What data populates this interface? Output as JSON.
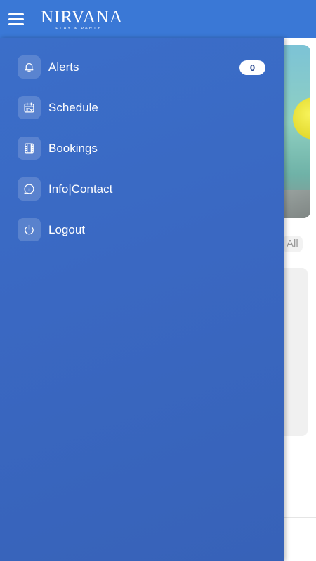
{
  "app": {
    "logo_main": "NIRVANA",
    "logo_sub": "PLAY & PARTY"
  },
  "background": {
    "view_all": "All"
  },
  "drawer": {
    "items": [
      {
        "label": "Alerts",
        "icon": "bell-icon",
        "badge": "0"
      },
      {
        "label": "Schedule",
        "icon": "calendar-icon"
      },
      {
        "label": "Bookings",
        "icon": "film-icon"
      },
      {
        "label": "Info|Contact",
        "icon": "chat-info-icon"
      },
      {
        "label": "Logout",
        "icon": "power-icon"
      }
    ]
  },
  "colors": {
    "appbar": "#3a78d6",
    "drawer": "#3a68c2",
    "badge_bg": "#ffffff"
  }
}
